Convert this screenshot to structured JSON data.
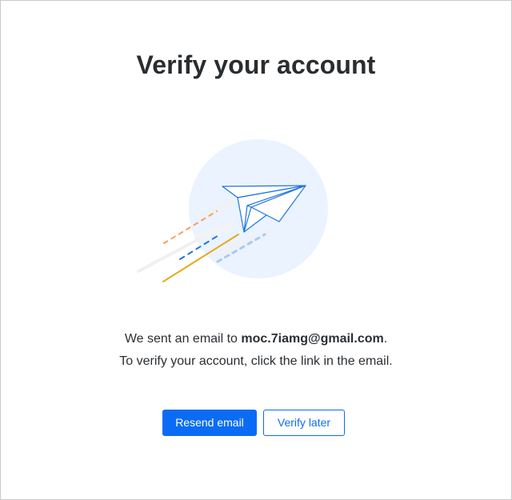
{
  "title": "Verify your account",
  "illustration": {
    "icon": "paper-plane-icon",
    "colors": {
      "circle": "#eaf3ff",
      "plane_stroke": "#1f74e0",
      "orange_dash": "#f3a25c",
      "blue_dash": "#1f74e0",
      "light_blue_dash": "#a9c9f3",
      "gold_line": "#e8a91e",
      "gray_line": "#f0f2f5"
    }
  },
  "message": {
    "line1_prefix": "We sent an email to ",
    "email": "moc.7iamg@gmail.com",
    "line1_suffix": ".",
    "line2": "To verify your account, click the link in the email."
  },
  "buttons": {
    "resend_label": "Resend email",
    "verify_later_label": "Verify later"
  },
  "colors": {
    "accent": "#0a6cf5"
  }
}
